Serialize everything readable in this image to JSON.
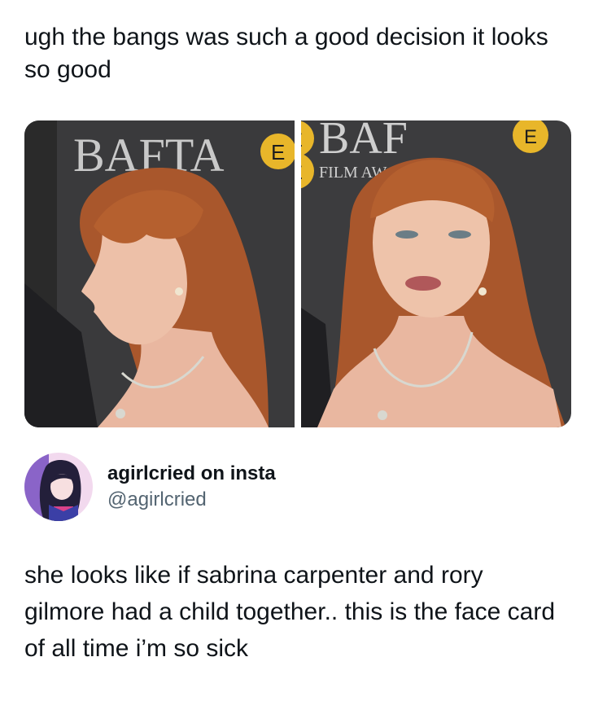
{
  "post": {
    "text": "ugh the bangs was such a good decision it looks so good"
  },
  "media": {
    "left_photo": {
      "backdrop_text": "BAFTA",
      "side_badge": "E"
    },
    "right_photo": {
      "backdrop_text": "BAF",
      "subtext": "FILM AW",
      "badge_top": "E",
      "badge_bottom": "E",
      "corner_badge": "E"
    }
  },
  "quoted": {
    "author_name": "agirlcried on insta",
    "author_handle": "@agirlcried",
    "text": "she looks like if sabrina carpenter and rory gilmore had a child together.. this is the face card of all time i’m so sick"
  },
  "colors": {
    "backdrop": "#3a3a3c",
    "hair": "#a9572c",
    "skin": "#e9b7a0",
    "gold": "#e8b62a",
    "text": "#0f1419",
    "muted": "#536471"
  }
}
